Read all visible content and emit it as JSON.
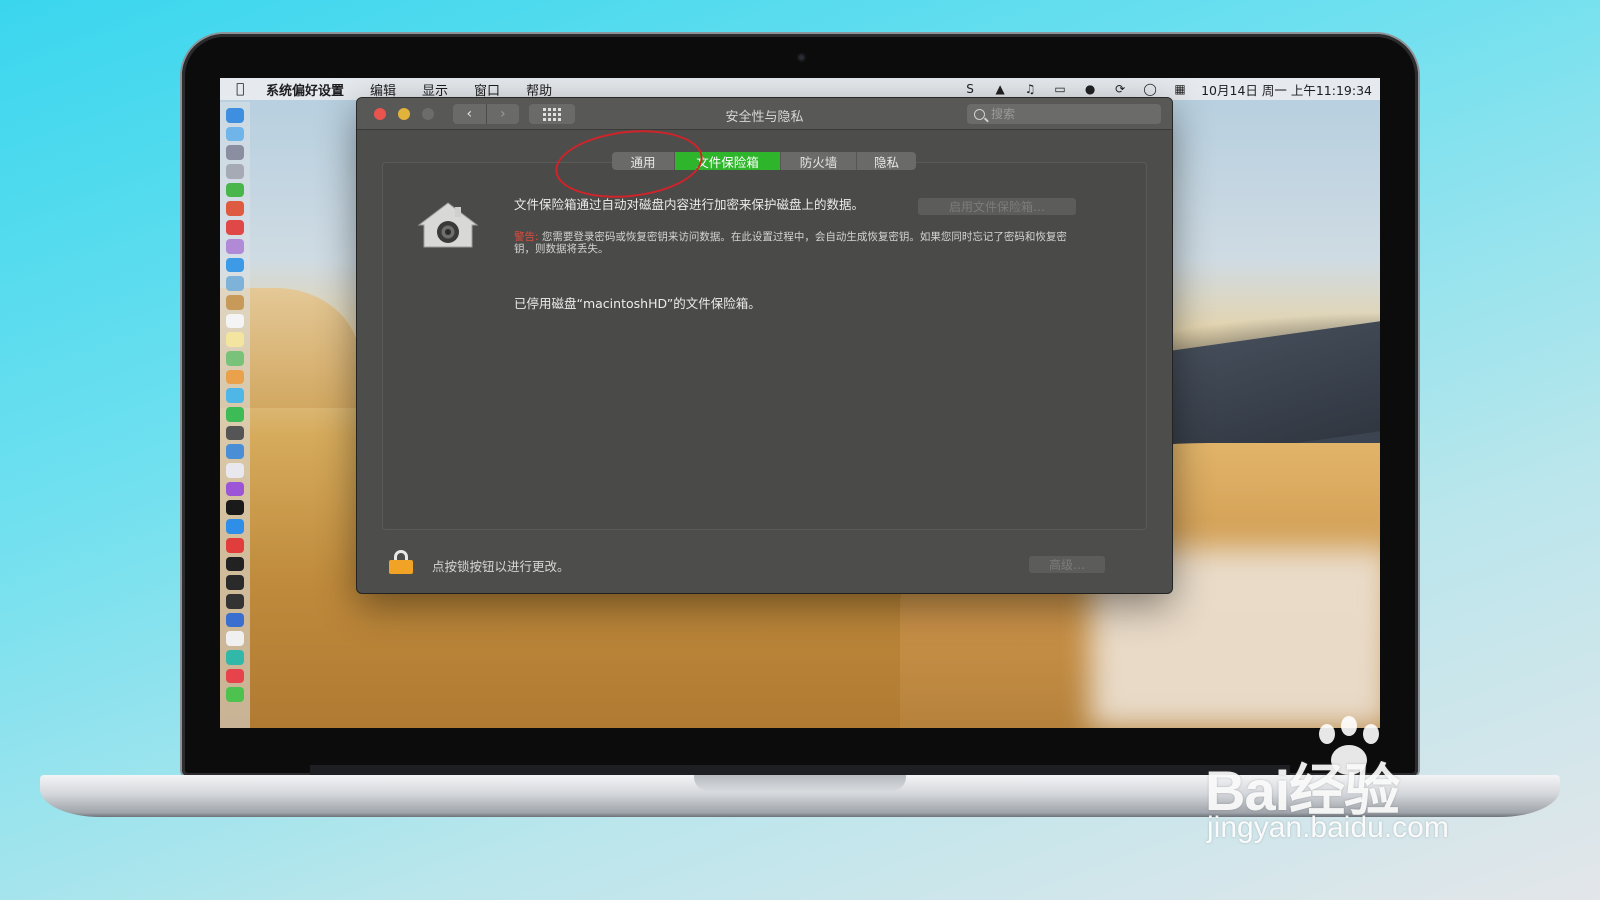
{
  "menubar": {
    "app_name": "系统偏好设置",
    "items": [
      "编辑",
      "显示",
      "窗口",
      "帮助"
    ],
    "clock": "10月14日 周一 上午11:19:34",
    "status_icons": [
      "skype-icon",
      "upload-icon",
      "music-icon",
      "display-icon",
      "notification-icon",
      "sync-icon",
      "language-icon",
      "input-method-icon"
    ]
  },
  "window": {
    "title": "安全性与隐私",
    "search_placeholder": "搜索",
    "tabs": [
      {
        "label": "通用",
        "selected": false
      },
      {
        "label": "文件保险箱",
        "selected": true
      },
      {
        "label": "防火墙",
        "selected": false
      },
      {
        "label": "隐私",
        "selected": false
      }
    ],
    "filevault": {
      "description": "文件保险箱通过自动对磁盘内容进行加密来保护磁盘上的数据。",
      "enable_button": "启用文件保险箱…",
      "warning_label": "警告:",
      "warning_text": "您需要登录密码或恢复密钥来访问数据。在此设置过程中，会自动生成恢复密钥。如果您同时忘记了密码和恢复密钥，则数据将丢失。",
      "status": "已停用磁盘“macintoshHD”的文件保险箱。"
    },
    "footer": {
      "lock_text": "点按锁按钮以进行更改。",
      "advanced_button": "高级…"
    }
  },
  "watermark": {
    "brand": "Bai经验",
    "url": "jingyan.baidu.com"
  },
  "colors": {
    "selected_tab": "#2fb52c",
    "annotation": "#d1232a",
    "lock": "#f0a324"
  }
}
